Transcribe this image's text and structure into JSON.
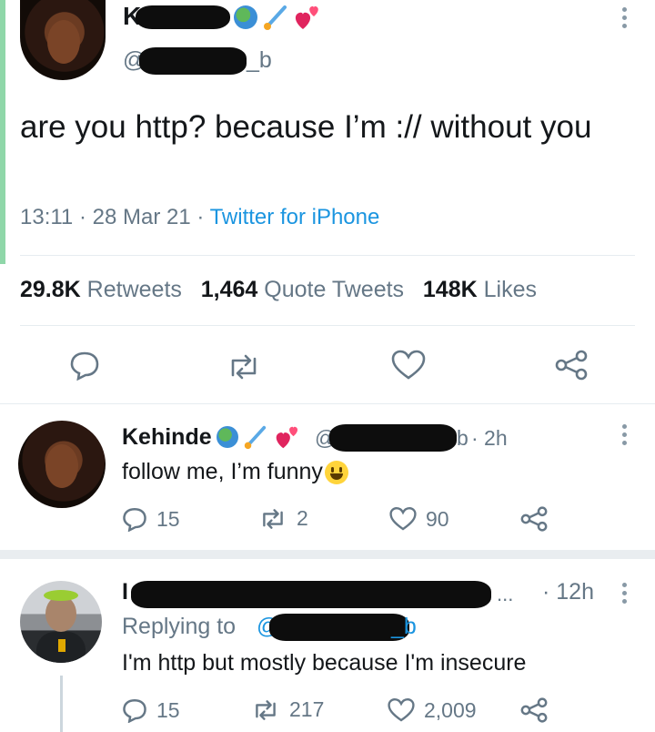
{
  "main_tweet": {
    "name_visible": "K",
    "handle_prefix": "@",
    "handle_suffix": "_b",
    "text": "are you http? because I’m :// without you",
    "time": "13:11",
    "date": "28 Mar 21",
    "source": "Twitter for iPhone",
    "sep": "·",
    "retweets_count": "29.8K",
    "retweets_label": "Retweets",
    "quotes_count": "1,464",
    "quotes_label": "Quote Tweets",
    "likes_count": "148K",
    "likes_label": "Likes"
  },
  "reply1": {
    "name": "Kehinde",
    "handle_prefix": "@",
    "handle_suffix": "b",
    "time": "· 2h",
    "text": "follow me, I’m funny",
    "emoji": "😃",
    "reply_count": "15",
    "retweet_count": "2",
    "like_count": "90"
  },
  "reply2": {
    "name_visible": "I",
    "name_tail": "...",
    "time": "· 12h",
    "replying_label": "Replying to",
    "replying_prefix": "@",
    "replying_suffix": "_b",
    "text": "I'm http but mostly because I'm insecure",
    "reply_count": "15",
    "retweet_count": "217",
    "like_count": "2,009"
  },
  "colors": {
    "accent": "#1b95e0",
    "muted": "#657786",
    "text": "#14171a",
    "divider": "#e6ecf0"
  },
  "icons": [
    "earth-emoji-icon",
    "comet-emoji-icon",
    "hearts-emoji-icon",
    "reply-icon",
    "retweet-icon",
    "like-icon",
    "share-icon",
    "more-icon"
  ]
}
